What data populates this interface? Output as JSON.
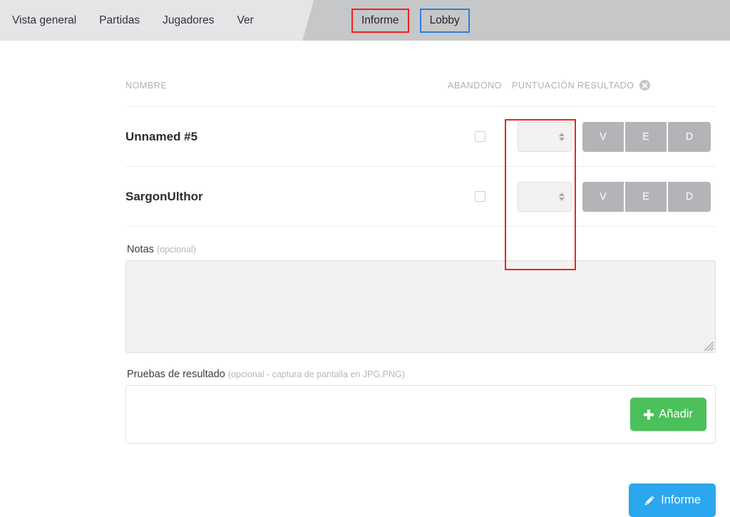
{
  "nav": {
    "left_items": [
      {
        "label": "Vista general",
        "name": "nav-vista-general"
      },
      {
        "label": "Partidas",
        "name": "nav-partidas"
      },
      {
        "label": "Jugadores",
        "name": "nav-jugadores"
      },
      {
        "label": "Ver",
        "name": "nav-ver"
      }
    ],
    "right_items": [
      {
        "label": "Informe",
        "annotation": "red"
      },
      {
        "label": "Lobby",
        "annotation": "blue"
      }
    ]
  },
  "table": {
    "headers": {
      "nombre": "NOMBRE",
      "abandono": "ABANDONO",
      "puntuacion": "PUNTUACIÓN",
      "resultado": "RESULTADO"
    },
    "clear_icon": "circle-x-icon",
    "rows": [
      {
        "name": "Unnamed #5",
        "abandono_checked": false,
        "puntuacion_value": "",
        "resultado_selected": null,
        "resultado_options": [
          "V",
          "E",
          "D"
        ]
      },
      {
        "name": "SargonUlthor",
        "abandono_checked": false,
        "puntuacion_value": "",
        "resultado_selected": null,
        "resultado_options": [
          "V",
          "E",
          "D"
        ]
      }
    ]
  },
  "notes": {
    "label": "Notas",
    "optional": "(opcional)",
    "value": "",
    "placeholder": ""
  },
  "proof": {
    "label": "Pruebas de resultado",
    "optional": "(opcional - captura de pantalla en JPG,PNG)",
    "add_button": "Añadir",
    "add_icon": "plus-icon"
  },
  "submit": {
    "label": "Informe",
    "icon": "pencil-icon"
  },
  "colors": {
    "nav_left_bg": "#e4e5e7",
    "nav_right_bg": "#c6c7c9",
    "annotation_red": "#ee2222",
    "annotation_blue": "#2f7fd8",
    "add_green": "#4cc05a",
    "submit_blue": "#2aa7ee",
    "ved_gray": "#b3b4b7",
    "input_bg": "#f2f2f2"
  }
}
